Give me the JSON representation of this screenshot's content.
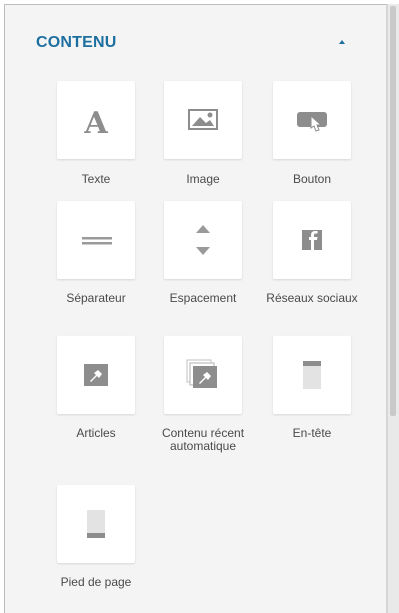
{
  "section": {
    "title": "CONTENU",
    "toggle_icon": "caret-up-icon",
    "title_color": "#1d6fa0"
  },
  "tiles": [
    {
      "label": "Texte",
      "icon": "text-icon"
    },
    {
      "label": "Image",
      "icon": "image-icon"
    },
    {
      "label": "Bouton",
      "icon": "button-icon"
    },
    {
      "label": "Séparateur",
      "icon": "divider-icon"
    },
    {
      "label": "Espacement",
      "icon": "spacing-icon"
    },
    {
      "label": "Réseaux sociaux",
      "icon": "facebook-icon"
    },
    {
      "label": "Articles",
      "icon": "article-icon"
    },
    {
      "label": "Contenu récent automatique",
      "icon": "recent-content-icon"
    },
    {
      "label": "En-tête",
      "icon": "header-icon"
    },
    {
      "label": "Pied de page",
      "icon": "footer-icon"
    }
  ]
}
